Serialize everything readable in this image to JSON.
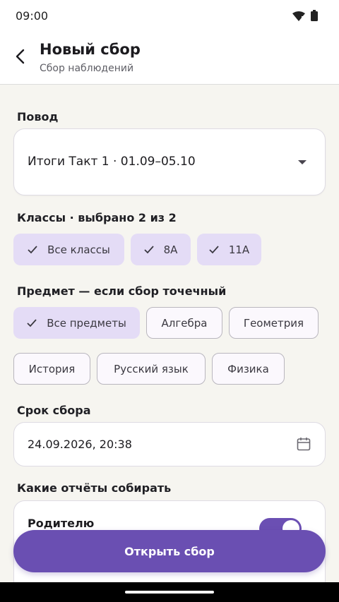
{
  "status_bar": {
    "time": "09:00"
  },
  "app_bar": {
    "title": "Новый сбор",
    "subtitle": "Сбор наблюдений"
  },
  "reason": {
    "label": "Повод",
    "value": "Итоги Такт 1 · 01.09–05.10"
  },
  "classes": {
    "label": "Классы · выбрано 2 из 2",
    "chips": [
      {
        "label": "Все классы",
        "selected": true
      },
      {
        "label": "8А",
        "selected": true
      },
      {
        "label": "11А",
        "selected": true
      }
    ]
  },
  "subject": {
    "label": "Предмет — если сбор точечный",
    "chips": [
      {
        "label": "Все предметы",
        "selected": true
      },
      {
        "label": "Алгебра",
        "selected": false
      },
      {
        "label": "Геометрия",
        "selected": false
      },
      {
        "label": "История",
        "selected": false
      },
      {
        "label": "Русский язык",
        "selected": false
      },
      {
        "label": "Физика",
        "selected": false
      }
    ]
  },
  "deadline": {
    "label": "Срок сбора",
    "value": "24.09.2026, 20:38"
  },
  "reports": {
    "label": "Какие отчёты собирать",
    "items": [
      {
        "label": "Родителю",
        "enabled": true
      }
    ]
  },
  "cta": {
    "label": "Открыть сбор"
  },
  "colors": {
    "accent": "#6a4fb2",
    "chip_selected": "#e4dcf6",
    "background": "#f6f5f0"
  },
  "icons": [
    "wifi-icon",
    "battery-icon",
    "back-arrow-icon",
    "dropdown-arrow-icon",
    "check-icon",
    "calendar-icon"
  ]
}
